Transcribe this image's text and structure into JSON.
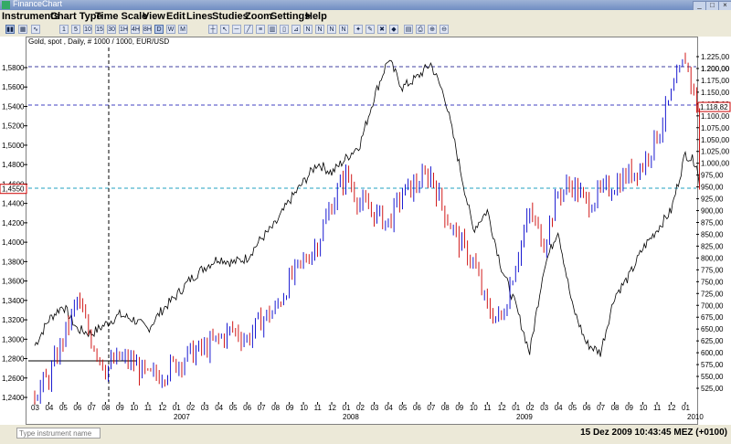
{
  "window": {
    "title": "FinanceChart"
  },
  "menu": [
    "Instruments",
    "Chart Type",
    "Time Scale",
    "View",
    "Edit",
    "Lines",
    "Studies",
    "Zoom",
    "Settings",
    "Help"
  ],
  "toolbar": {
    "timescale_buttons": [
      "1",
      "5",
      "10",
      "15",
      "30",
      "1H",
      "4H",
      "8H",
      "D",
      "W",
      "M"
    ],
    "selected_timescale": "D"
  },
  "chart": {
    "subtitle": "Gold, spot , Daily, # 1000 / 1000, EUR/USD",
    "left_axis_ticks": [
      "1,5800",
      "1,5600",
      "1,5400",
      "1,5200",
      "1,5000",
      "1,4800",
      "1,4600",
      "1,4400",
      "1,4200",
      "1,4000",
      "1,3800",
      "1,3600",
      "1,3400",
      "1,3200",
      "1,3000",
      "1,2800",
      "1,2600",
      "1,2400"
    ],
    "left_highlight": "1,4550",
    "right_axis_ticks": [
      "1.225,00",
      "1.200,00",
      "1.175,00",
      "1.150,00",
      "1.125,00",
      "1.100,00",
      "1.075,00",
      "1.050,00",
      "1.025,00",
      "1.000,00",
      "975,00",
      "950,00",
      "925,00",
      "900,00",
      "875,00",
      "850,00",
      "825,00",
      "800,00",
      "775,00",
      "750,00",
      "725,00",
      "700,00",
      "675,00",
      "650,00",
      "625,00",
      "600,00",
      "575,00",
      "550,00",
      "525,00"
    ],
    "right_highlight": "1.118,82",
    "month_ticks": [
      "03",
      "04",
      "05",
      "06",
      "07",
      "08",
      "09",
      "10",
      "11",
      "12",
      "01",
      "02",
      "03",
      "04",
      "05",
      "06",
      "07",
      "08",
      "09",
      "10",
      "11",
      "12",
      "01",
      "02",
      "03",
      "04",
      "05",
      "06",
      "07",
      "08",
      "09",
      "10",
      "11",
      "12",
      "01",
      "02",
      "03",
      "04",
      "05",
      "06",
      "07",
      "08",
      "09",
      "10",
      "11",
      "12",
      "01"
    ],
    "year_labels": [
      "2007",
      "2008",
      "2009",
      "2010"
    ],
    "colors": {
      "gold_line": "#000000",
      "eur_up": "#0000cc",
      "eur_down": "#cc0000",
      "h_line_blue": "#4040c0",
      "h_line_cyan": "#20a0c0"
    }
  },
  "status": {
    "instrument_placeholder": "Type instrument name",
    "datetime": "15 Dez 2009 10:43:45  MEZ (+0100)"
  }
}
